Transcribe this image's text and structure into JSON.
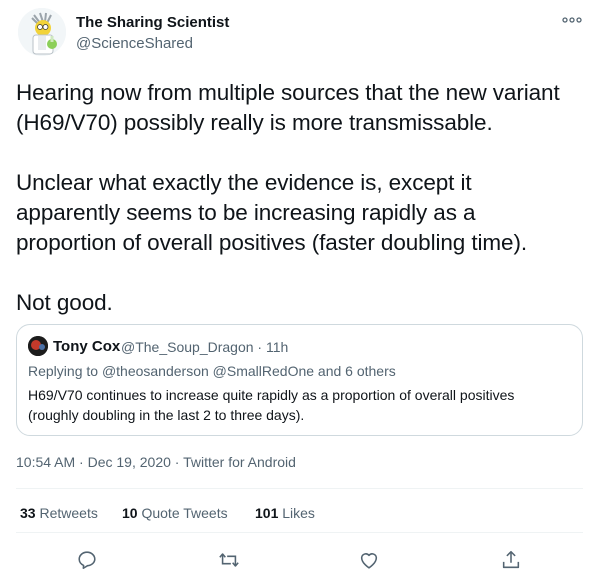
{
  "author": {
    "display_name": "The Sharing Scientist",
    "handle": "@ScienceShared",
    "avatar_icon": "scientist-cartoon-avatar"
  },
  "tweet": {
    "text": "Hearing now from multiple sources that the new variant\n(H69/V70) possibly really is more transmissable.\n\nUnclear what exactly the evidence is, except it\napparently seems to be increasing rapidly as a\nproportion of overall positives (faster doubling time).\n\nNot good."
  },
  "quoted_tweet": {
    "display_name": "Tony Cox",
    "handle": "@The_Soup_Dragon",
    "time_ago": "11h",
    "replying_to_prefix": "Replying to",
    "replying_to": "@theosanderson @SmallRedOne and 6 others",
    "text": "H69/V70 continues to increase quite rapidly as a proportion of overall positives (roughly doubling in the last 2 to three days)."
  },
  "meta": {
    "time": "10:54 AM",
    "date": "Dec 19, 2020",
    "source": "Twitter for Android"
  },
  "stats": {
    "retweets_count": "33",
    "retweets_label": "Retweets",
    "quote_count": "10",
    "quote_label": "Quote Tweets",
    "likes_count": "101",
    "likes_label": "Likes"
  },
  "actions": [
    "reply-icon",
    "retweet-icon",
    "like-icon",
    "share-icon"
  ],
  "colors": {
    "text_primary": "#0f1419",
    "text_secondary": "#536471",
    "border": "#cfd9de",
    "action_icon": "#536471"
  }
}
